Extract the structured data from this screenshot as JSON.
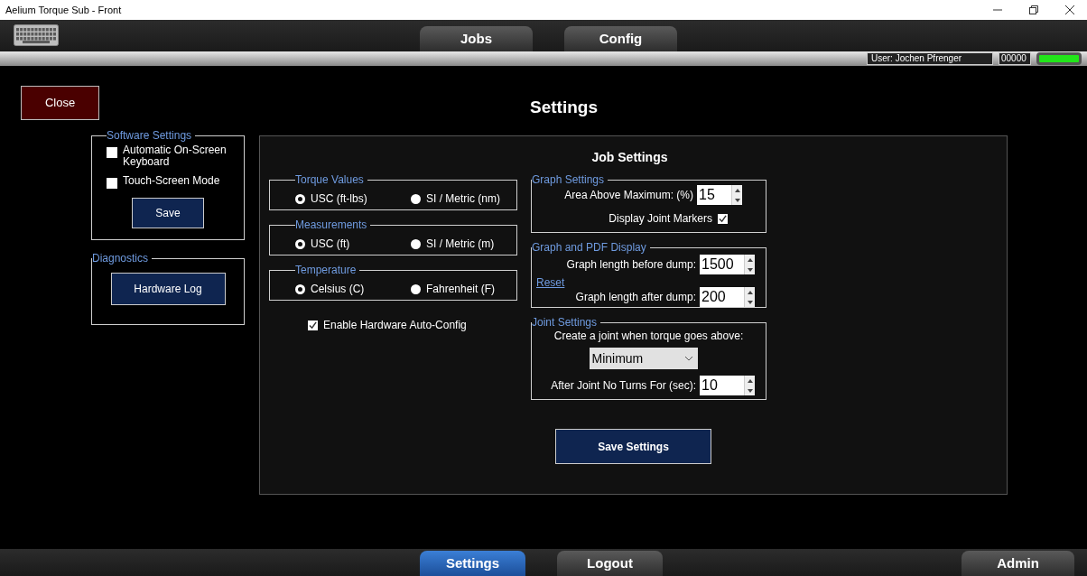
{
  "window": {
    "title": "Aelium Torque Sub - Front"
  },
  "top_tabs": [
    {
      "label": "Jobs",
      "selected": false
    },
    {
      "label": "Config",
      "selected": false
    }
  ],
  "status": {
    "user": "User: Jochen Pfrenger",
    "counter": "00000",
    "connected": true
  },
  "close_button": "Close",
  "page_title": "Settings",
  "software_settings": {
    "title": "Software Settings",
    "options": [
      {
        "label": "Automatic On-Screen Keyboard",
        "checked": false
      },
      {
        "label": "Touch-Screen Mode",
        "checked": false
      }
    ],
    "save_button": "Save"
  },
  "diagnostics": {
    "title": "Diagnostics",
    "button": "Hardware Log"
  },
  "job_settings": {
    "title": "Job Settings",
    "unit_groups": [
      {
        "title": "Torque Values",
        "options": [
          {
            "label": "USC (ft-lbs)",
            "selected": true
          },
          {
            "label": "SI / Metric (nm)",
            "selected": false
          }
        ]
      },
      {
        "title": "Measurements",
        "options": [
          {
            "label": "USC (ft)",
            "selected": true
          },
          {
            "label": "SI / Metric (m)",
            "selected": false
          }
        ]
      },
      {
        "title": "Temperature",
        "options": [
          {
            "label": "Celsius (C)",
            "selected": true
          },
          {
            "label": "Fahrenheit (F)",
            "selected": false
          }
        ]
      }
    ],
    "auto_config": {
      "label": "Enable Hardware Auto-Config",
      "checked": true
    },
    "graph_settings": {
      "title": "Graph Settings",
      "area_label": "Area Above Maximum: (%)",
      "area_value": "15",
      "markers_label": "Display Joint Markers",
      "markers_checked": true
    },
    "graph_pdf": {
      "title": "Graph and PDF Display",
      "before_label": "Graph length before dump:",
      "before_value": "1500",
      "reset_link": "Reset",
      "after_label": "Graph length after dump:",
      "after_value": "200"
    },
    "joint_settings": {
      "title": "Joint Settings",
      "prompt": "Create a joint when torque goes above:",
      "trigger": "Minimum",
      "turns_label": "After Joint No Turns For (sec):",
      "turns_value": "10"
    },
    "save_button": "Save Settings"
  },
  "bottom_tabs": [
    {
      "label": "Settings",
      "selected": true
    },
    {
      "label": "Logout",
      "selected": false
    },
    {
      "label": "Admin",
      "selected": false
    }
  ]
}
